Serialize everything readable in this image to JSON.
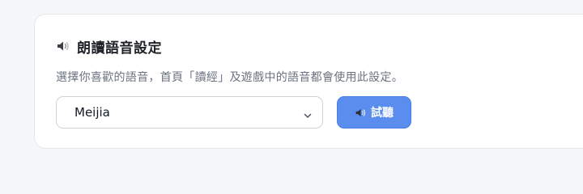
{
  "settings": {
    "title_icon": "speaker-icon",
    "title": "朗讀語音設定",
    "description": "選擇你喜歡的語音，首頁「讀經」及遊戲中的語音都會使用此設定。",
    "voice_select": {
      "selected": "Meijia",
      "icon": "chevron-down-icon"
    },
    "preview_button": {
      "icon": "speaker-icon",
      "label": "試聽"
    }
  },
  "colors": {
    "accent": "#5b8def",
    "title_text": "#1f2328",
    "muted_text": "#6b7280"
  }
}
